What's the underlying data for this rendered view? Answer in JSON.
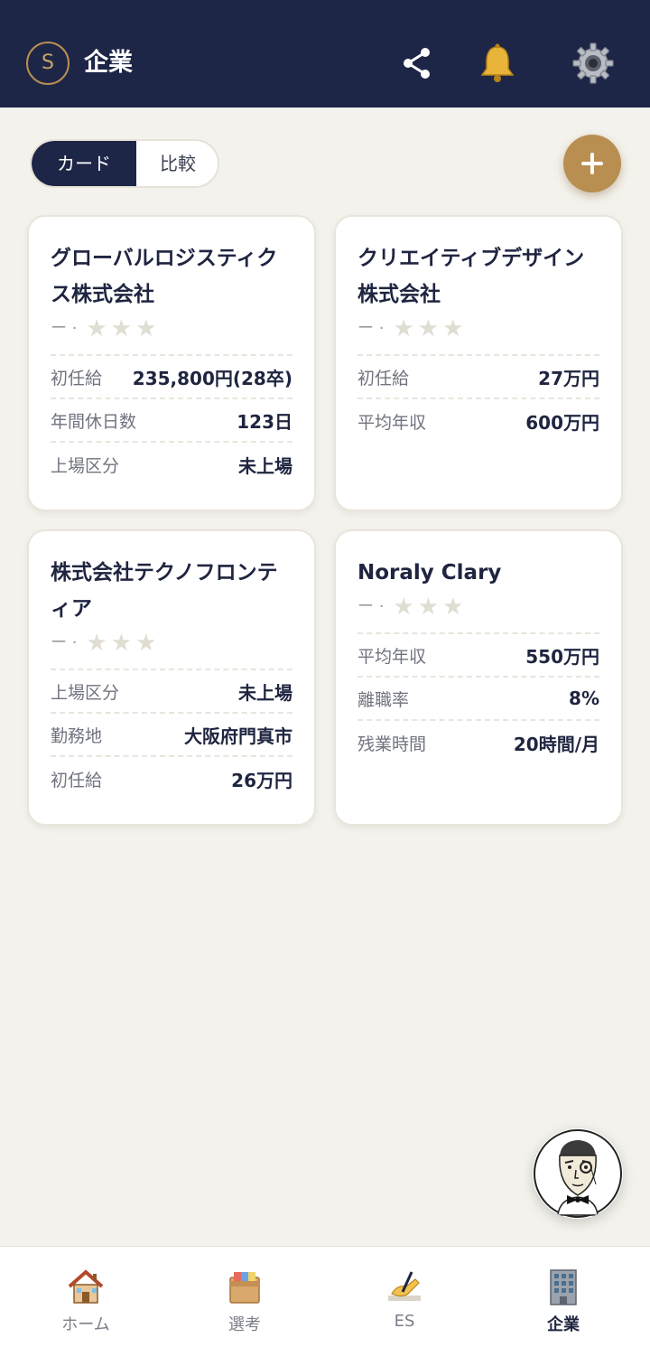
{
  "header": {
    "avatar_letter": "S",
    "title": "企業",
    "icons": [
      "share-icon",
      "bell-icon",
      "gear-icon"
    ]
  },
  "view_toggle": {
    "options": [
      "カード",
      "比較"
    ],
    "selected": "カード"
  },
  "add_button": {
    "icon": "plus-icon"
  },
  "companies": [
    {
      "name": "グローバルロジスティクス株式会社",
      "rating_text": "ー ·",
      "stars": 3,
      "rows": [
        {
          "label": "初任給",
          "value": "235,800円(28卒)"
        },
        {
          "label": "年間休日数",
          "value": "123日"
        },
        {
          "label": "上場区分",
          "value": "未上場"
        }
      ]
    },
    {
      "name": "クリエイティブデザイン株式会社",
      "rating_text": "ー ·",
      "stars": 3,
      "rows": [
        {
          "label": "初任給",
          "value": "27万円"
        },
        {
          "label": "平均年収",
          "value": "600万円"
        }
      ]
    },
    {
      "name": "株式会社テクノフロンティア",
      "rating_text": "ー ·",
      "stars": 3,
      "rows": [
        {
          "label": "上場区分",
          "value": "未上場"
        },
        {
          "label": "勤務地",
          "value": "大阪府門真市"
        },
        {
          "label": "初任給",
          "value": "26万円"
        }
      ]
    },
    {
      "name": "Noraly Clary",
      "rating_text": "ー ·",
      "stars": 3,
      "rows": [
        {
          "label": "平均年収",
          "value": "550万円"
        },
        {
          "label": "離職率",
          "value": "8%"
        },
        {
          "label": "残業時間",
          "value": "20時間/月"
        }
      ]
    }
  ],
  "mascot": {
    "icon": "monocle-gentleman-icon"
  },
  "tabbar": {
    "items": [
      {
        "label": "ホーム",
        "icon": "house-icon"
      },
      {
        "label": "選考",
        "icon": "file-box-icon"
      },
      {
        "label": "ES",
        "icon": "writing-hand-icon"
      },
      {
        "label": "企業",
        "icon": "office-building-icon",
        "active": true
      }
    ]
  },
  "colors": {
    "navy": "#1e2647",
    "gold": "#b88f51",
    "background": "#f4f2ec"
  }
}
